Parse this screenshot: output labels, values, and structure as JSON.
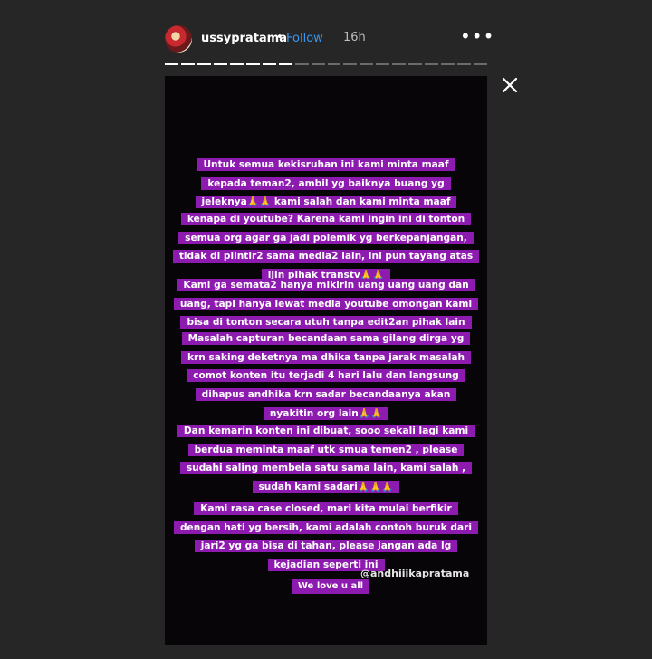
{
  "header": {
    "username": "ussypratama",
    "separator": "•",
    "follow_label": "Follow",
    "time": "16h",
    "more_icon": "more-horizontal-icon",
    "more_label": "•••"
  },
  "progress": {
    "total_segments": 20,
    "completed_segments": 8
  },
  "close_icon": "close-icon",
  "story": {
    "blocks": [
      [
        "Untuk semua kekisruhan ini kami minta maaf",
        "kepada teman2, ambil yg baiknya buang yg",
        "jeleknya🙏🙏 kami salah dan kami minta maaf"
      ],
      [
        "kenapa di youtube? Karena kami ingin ini di tonton",
        "semua org agar ga jadi polemik yg berkepanjangan,",
        "tidak di plintir2 sama media2 lain, ini pun tayang atas",
        "ijin pihak transtv🙏🙏"
      ],
      [
        "Kami ga semata2 hanya mikirin uang uang uang dan",
        "uang, tapi hanya lewat media youtube omongan kami",
        "bisa di tonton secara utuh tanpa edit2an pihak lain"
      ],
      [
        "Masalah capturan becandaan sama gilang dirga yg",
        "krn saking deketnya  ma dhika tanpa jarak masalah",
        "comot konten itu terjadi 4 hari lalu dan langsung",
        "dihapus andhika krn sadar becandaanya akan",
        "nyakitin org lain🙏🙏"
      ],
      [
        "Dan kemarin konten ini dibuat, sooo sekali lagi kami",
        "berdua meminta maaf utk smua temen2 , please",
        "sudahi saling membela satu sama lain, kami salah ,",
        "sudah kami sadari🙏🙏🙏"
      ],
      [
        "Kami rasa case closed, mari kita mulai berfikir",
        "dengan hati yg bersih, kami adalah contoh buruk dari",
        "jari2 yg ga bisa di tahan, please jangan ada lg",
        "kejadian seperti ini"
      ]
    ],
    "handle": "@andhiiikapratama",
    "sign_off": "We love u all"
  },
  "colors": {
    "background": "#262626",
    "story_bg": "#070508",
    "highlight": "#8e1bb0",
    "follow": "#3897f0"
  }
}
